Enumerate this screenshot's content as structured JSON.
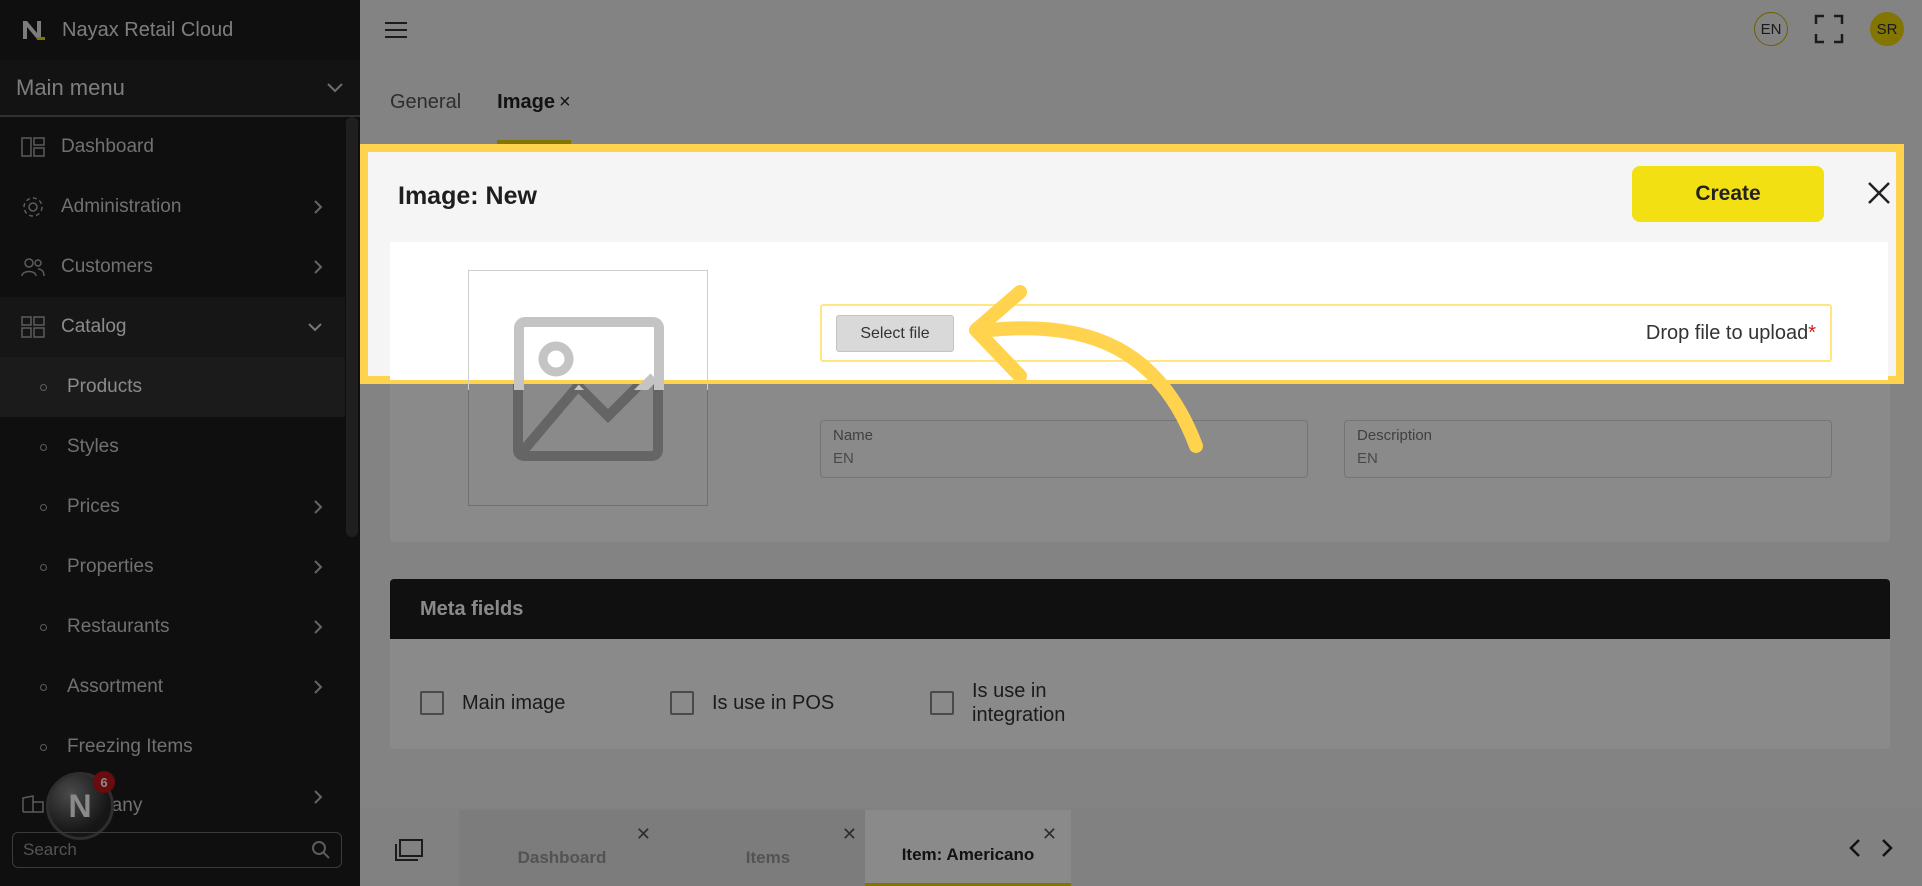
{
  "app": {
    "title": "Nayax Retail Cloud"
  },
  "sidebar": {
    "menu_title": "Main menu",
    "items": [
      {
        "label": "Dashboard",
        "icon": "dashboard-icon"
      },
      {
        "label": "Administration",
        "icon": "gear-icon"
      },
      {
        "label": "Customers",
        "icon": "users-icon"
      },
      {
        "label": "Catalog",
        "icon": "catalog-icon"
      }
    ],
    "catalog_sub": [
      {
        "label": "Products"
      },
      {
        "label": "Styles"
      },
      {
        "label": "Prices"
      },
      {
        "label": "Properties"
      },
      {
        "label": "Restaurants"
      },
      {
        "label": "Assortment"
      },
      {
        "label": "Freezing Items"
      },
      {
        "label": "Company"
      }
    ],
    "search_placeholder": "Search",
    "notification_count": "6"
  },
  "topbar": {
    "lang": "EN",
    "user_initials": "SR"
  },
  "tabs": [
    {
      "label": "General"
    },
    {
      "label": "Image"
    }
  ],
  "form": {
    "name_label": "Name",
    "name_lang": "EN",
    "description_label": "Description",
    "description_lang": "EN"
  },
  "meta": {
    "title": "Meta fields",
    "checkboxes": [
      {
        "label": "Main image"
      },
      {
        "label": "Is use in POS"
      },
      {
        "label": "Is use in integration"
      }
    ]
  },
  "bottom_tabs": [
    {
      "label": "Dashboard"
    },
    {
      "label": "Items"
    },
    {
      "label": "Item: Americano"
    }
  ],
  "dialog": {
    "title": "Image: New",
    "create_label": "Create",
    "select_file_label": "Select file",
    "drop_label": "Drop file to upload",
    "required_mark": "*"
  },
  "colors": {
    "accent": "#f1d900",
    "highlight": "#ffd34d",
    "sidebar": "#1d1d1d"
  }
}
